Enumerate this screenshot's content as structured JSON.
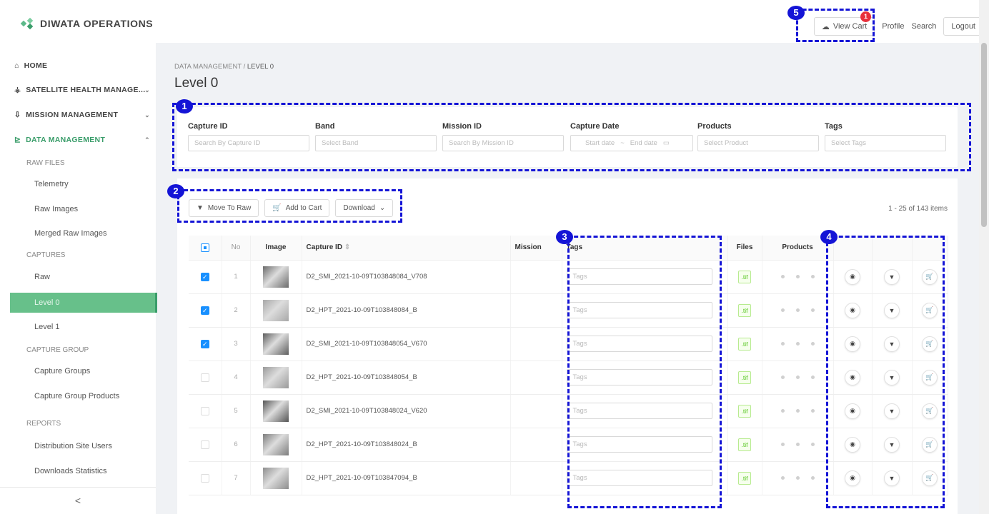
{
  "header": {
    "brand": "DIWATA OPERATIONS",
    "view_cart": "View Cart",
    "cart_badge": "1",
    "profile": "Profile",
    "search": "Search",
    "logout": "Logout"
  },
  "sidebar": {
    "home": "HOME",
    "satellite": "SATELLITE HEALTH MANAGE...",
    "mission": "MISSION MANAGEMENT",
    "data": "DATA MANAGEMENT",
    "raw_files": "RAW FILES",
    "telemetry": "Telemetry",
    "raw_images": "Raw Images",
    "merged_raw": "Merged Raw Images",
    "captures": "CAPTURES",
    "raw": "Raw",
    "level0": "Level 0",
    "level1": "Level 1",
    "capture_group": "CAPTURE GROUP",
    "capture_groups": "Capture Groups",
    "capture_group_products": "Capture Group Products",
    "reports": "REPORTS",
    "distribution": "Distribution Site Users",
    "downloads": "Downloads Statistics",
    "collapse": "<"
  },
  "main": {
    "breadcrumb_root": "DATA MANAGEMENT",
    "breadcrumb_sep": "/",
    "breadcrumb_current": "LEVEL 0",
    "title": "Level 0"
  },
  "filters": {
    "capture_id": {
      "label": "Capture ID",
      "placeholder": "Search By Capture ID"
    },
    "band": {
      "label": "Band",
      "placeholder": "Select Band"
    },
    "mission_id": {
      "label": "Mission ID",
      "placeholder": "Search By Mission ID"
    },
    "capture_date": {
      "label": "Capture Date",
      "start": "Start date",
      "sep": "~",
      "end": "End date"
    },
    "products": {
      "label": "Products",
      "placeholder": "Select Product"
    },
    "tags": {
      "label": "Tags",
      "placeholder": "Select Tags"
    }
  },
  "toolbar": {
    "move_to_raw": "Move To Raw",
    "add_to_cart": "Add to Cart",
    "download": "Download",
    "count": "1 - 25 of 143 items"
  },
  "table": {
    "headers": {
      "no": "No",
      "image": "Image",
      "capture_id": "Capture ID",
      "mission": "Mission",
      "tags": "Tags",
      "files": "Files",
      "products": "Products"
    },
    "tag_placeholder": "Tags",
    "rows": [
      {
        "no": "1",
        "capture_id": "D2_SMI_2021-10-09T103848084_V708",
        "file": ".tif",
        "checked": true
      },
      {
        "no": "2",
        "capture_id": "D2_HPT_2021-10-09T103848084_B",
        "file": ".tif",
        "checked": true
      },
      {
        "no": "3",
        "capture_id": "D2_SMI_2021-10-09T103848054_V670",
        "file": ".tif",
        "checked": true
      },
      {
        "no": "4",
        "capture_id": "D2_HPT_2021-10-09T103848054_B",
        "file": ".tif",
        "checked": false
      },
      {
        "no": "5",
        "capture_id": "D2_SMI_2021-10-09T103848024_V620",
        "file": ".tif",
        "checked": false
      },
      {
        "no": "6",
        "capture_id": "D2_HPT_2021-10-09T103848024_B",
        "file": ".tif",
        "checked": false
      },
      {
        "no": "7",
        "capture_id": "D2_HPT_2021-10-09T103847094_B",
        "file": ".tif",
        "checked": false
      }
    ]
  },
  "annotations": [
    "1",
    "2",
    "3",
    "4",
    "5"
  ],
  "colors": {
    "accent": "#3a9d6a",
    "active_bg": "#67c08a",
    "annotation": "#1414d6",
    "primary": "#1890ff"
  }
}
